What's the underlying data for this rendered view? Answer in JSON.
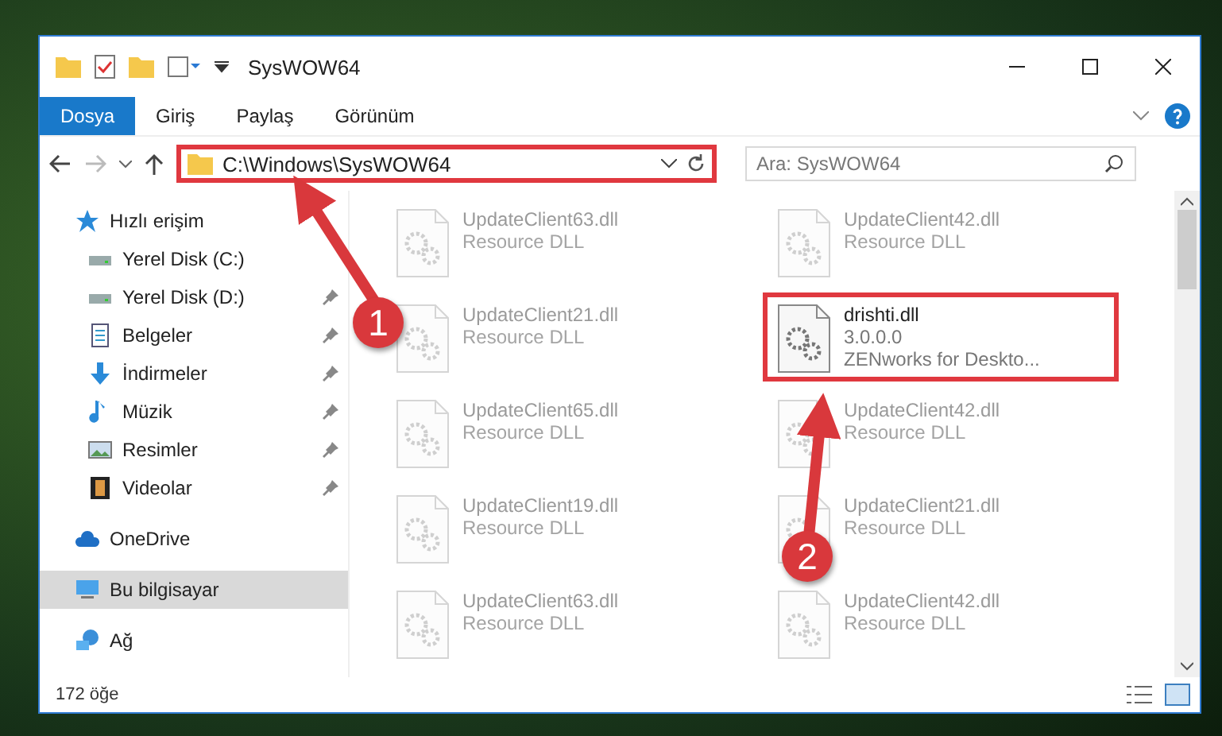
{
  "window": {
    "title": "SysWOW64"
  },
  "ribbon_tabs": [
    {
      "label": "Dosya",
      "selected": true
    },
    {
      "label": "Giriş",
      "selected": false
    },
    {
      "label": "Paylaş",
      "selected": false
    },
    {
      "label": "Görünüm",
      "selected": false
    }
  ],
  "address_bar": {
    "path": "C:\\Windows\\SysWOW64",
    "highlighted": true
  },
  "search": {
    "placeholder": "Ara: SysWOW64"
  },
  "sidebar": {
    "items": [
      {
        "label": "Hızlı erişim",
        "kind": "star",
        "pinned": false,
        "selected": false
      },
      {
        "label": "Yerel Disk (C:)",
        "kind": "drive",
        "pinned": false,
        "selected": false,
        "child": true
      },
      {
        "label": "Yerel Disk (D:)",
        "kind": "drive",
        "pinned": true,
        "selected": false,
        "child": true
      },
      {
        "label": "Belgeler",
        "kind": "docs",
        "pinned": true,
        "selected": false,
        "child": true
      },
      {
        "label": "İndirmeler",
        "kind": "download",
        "pinned": true,
        "selected": false,
        "child": true
      },
      {
        "label": "Müzik",
        "kind": "music",
        "pinned": true,
        "selected": false,
        "child": true
      },
      {
        "label": "Resimler",
        "kind": "pictures",
        "pinned": true,
        "selected": false,
        "child": true
      },
      {
        "label": "Videolar",
        "kind": "video",
        "pinned": true,
        "selected": false,
        "child": true
      },
      {
        "label": "OneDrive",
        "kind": "cloud",
        "pinned": false,
        "selected": false
      },
      {
        "label": "Bu bilgisayar",
        "kind": "pc",
        "pinned": false,
        "selected": true
      },
      {
        "label": "Ağ",
        "kind": "network",
        "pinned": false,
        "selected": false
      }
    ]
  },
  "files": [
    {
      "name": "UpdateClient63.dll",
      "lines": [
        "Resource DLL"
      ],
      "faded": true,
      "highlighted": false
    },
    {
      "name": "UpdateClient42.dll",
      "lines": [
        "Resource DLL"
      ],
      "faded": true,
      "highlighted": false
    },
    {
      "name": "UpdateClient21.dll",
      "lines": [
        "Resource DLL"
      ],
      "faded": true,
      "highlighted": false
    },
    {
      "name": "drishti.dll",
      "lines": [
        "3.0.0.0",
        "ZENworks for Deskto..."
      ],
      "faded": false,
      "highlighted": true
    },
    {
      "name": "UpdateClient65.dll",
      "lines": [
        "Resource DLL"
      ],
      "faded": true,
      "highlighted": false
    },
    {
      "name": "UpdateClient42.dll",
      "lines": [
        "Resource DLL"
      ],
      "faded": true,
      "highlighted": false
    },
    {
      "name": "UpdateClient19.dll",
      "lines": [
        "Resource DLL"
      ],
      "faded": true,
      "highlighted": false
    },
    {
      "name": "UpdateClient21.dll",
      "lines": [
        "Resource DLL"
      ],
      "faded": true,
      "highlighted": false
    },
    {
      "name": "UpdateClient63.dll",
      "lines": [
        "Resource DLL"
      ],
      "faded": true,
      "highlighted": false
    },
    {
      "name": "UpdateClient42.dll",
      "lines": [
        "Resource DLL"
      ],
      "faded": true,
      "highlighted": false
    }
  ],
  "status_bar": {
    "count": "172 öğe"
  },
  "callouts": [
    {
      "number": "1"
    },
    {
      "number": "2"
    }
  ]
}
